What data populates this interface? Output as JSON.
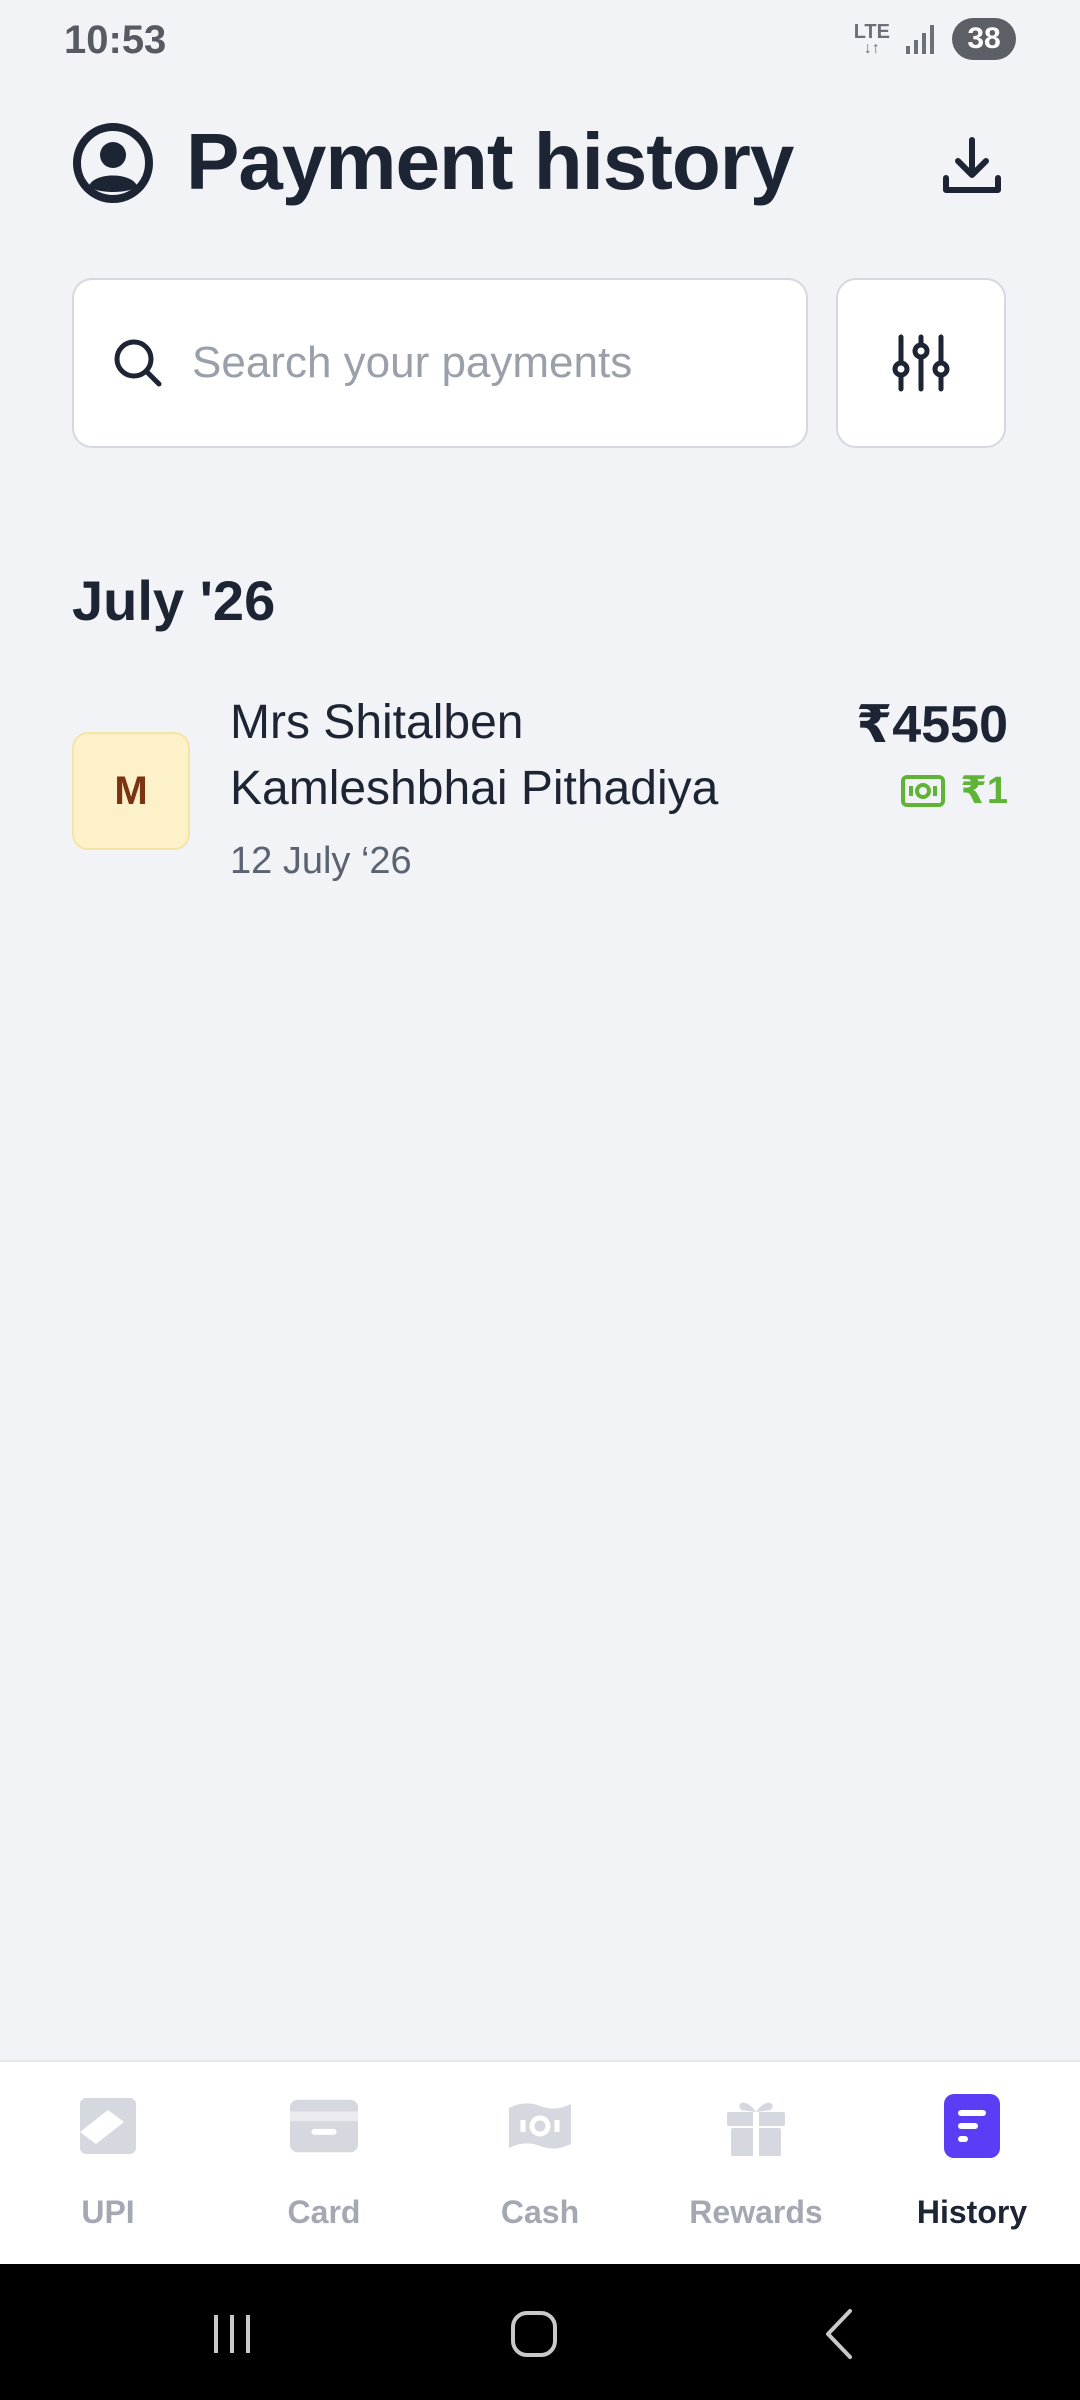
{
  "status_bar": {
    "time": "10:53",
    "network": "LTE",
    "battery": "38"
  },
  "header": {
    "title": "Payment history"
  },
  "search": {
    "placeholder": "Search your payments"
  },
  "section": {
    "month": "July '26"
  },
  "payments": [
    {
      "avatar_initial": "M",
      "name": "Mrs Shitalben Kamleshbhai Pithadiya",
      "date": "12 July ‘26",
      "amount": "₹4550",
      "cashback": "₹1"
    }
  ],
  "nav": {
    "items": [
      {
        "label": "UPI",
        "icon": "upi-icon"
      },
      {
        "label": "Card",
        "icon": "card-icon"
      },
      {
        "label": "Cash",
        "icon": "cash-icon"
      },
      {
        "label": "Rewards",
        "icon": "gift-icon"
      },
      {
        "label": "History",
        "icon": "history-icon",
        "active": true
      }
    ]
  },
  "colors": {
    "background": "#f2f3f7",
    "accent": "#5b3df5",
    "cashback_green": "#5fb336",
    "avatar_bg": "#fdf1c9"
  }
}
